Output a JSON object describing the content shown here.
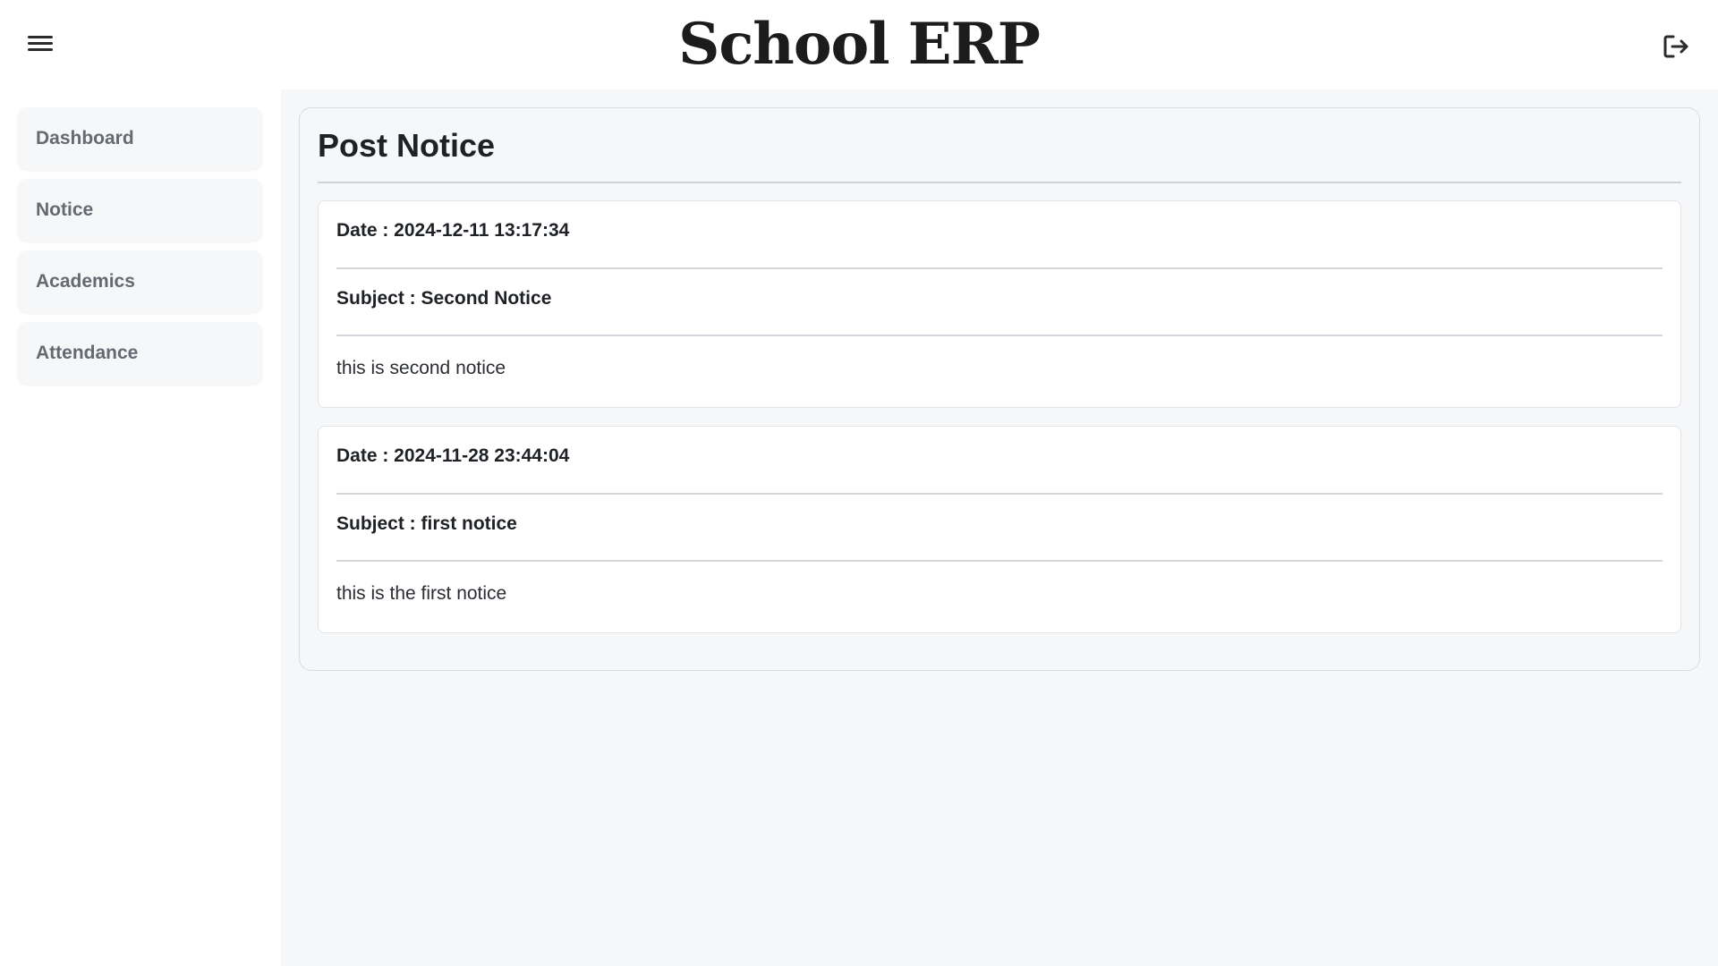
{
  "app": {
    "title": "School ERP"
  },
  "header": {
    "menu_icon": "hamburger-menu-icon",
    "logout_icon": "logout-icon"
  },
  "sidebar": {
    "items": [
      {
        "label": "Dashboard"
      },
      {
        "label": "Notice"
      },
      {
        "label": "Academics"
      },
      {
        "label": "Attendance"
      }
    ]
  },
  "main": {
    "title": "Post Notice",
    "notices": [
      {
        "date": "Date : 2024-12-11 13:17:34",
        "subject": "Subject : Second Notice",
        "body": "this is second notice"
      },
      {
        "date": "Date : 2024-11-28 23:44:04",
        "subject": "Subject : first notice",
        "body": "this is the first notice"
      }
    ]
  }
}
